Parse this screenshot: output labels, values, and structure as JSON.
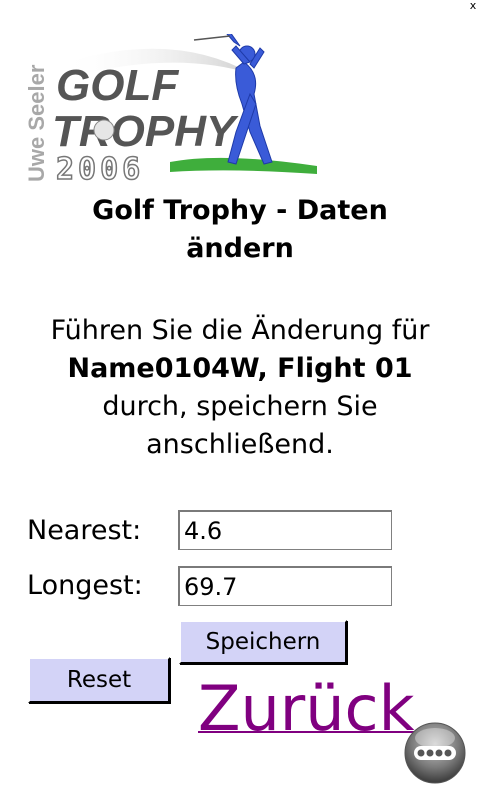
{
  "window": {
    "close_label": "x"
  },
  "logo": {
    "vertical_text": "Uwe Seeler",
    "line1": "GOLF",
    "line2": "TROPHY",
    "year": "2006"
  },
  "heading": {
    "line1": "Golf Trophy - Daten",
    "line2": "ändern"
  },
  "instruction": {
    "line1": "Führen Sie die Änderung für",
    "line2_bold": "Name0104W, Flight 01",
    "line3": "durch, speichern Sie",
    "line4": "anschließend."
  },
  "form": {
    "nearest": {
      "label": "Nearest:",
      "value": "4.6"
    },
    "longest": {
      "label": "Longest:",
      "value": "69.7"
    }
  },
  "buttons": {
    "save": "Speichern",
    "reset": "Reset"
  },
  "back_link": "Zurück",
  "colors": {
    "button_bg": "#d3d3f7",
    "link": "#800080",
    "golfer": "#3a5bd8",
    "grass": "#3fae3c"
  },
  "icons": {
    "menu": "dots-menu-icon"
  }
}
